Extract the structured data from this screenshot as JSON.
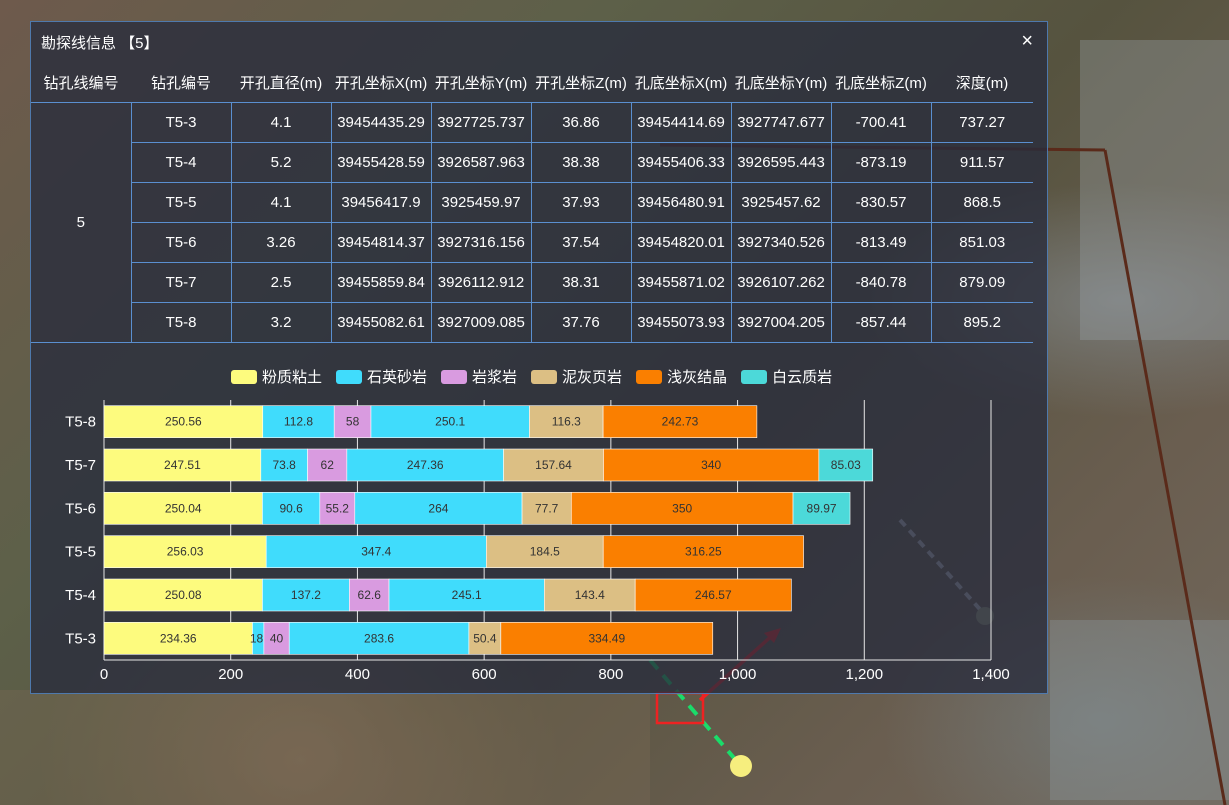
{
  "dialog": {
    "title": "勘探线信息 【5】",
    "close_symbol": "×"
  },
  "table": {
    "headers": [
      "钻孔线编号",
      "钻孔编号",
      "开孔直径(m)",
      "开孔坐标X(m)",
      "开孔坐标Y(m)",
      "开孔坐标Z(m)",
      "孔底坐标X(m)",
      "孔底坐标Y(m)",
      "孔底坐标Z(m)",
      "深度(m)"
    ],
    "group_value": "5",
    "rows": [
      [
        "T5-3",
        "4.1",
        "39454435.29",
        "3927725.737",
        "36.86",
        "39454414.69",
        "3927747.677",
        "-700.41",
        "737.27"
      ],
      [
        "T5-4",
        "5.2",
        "39455428.59",
        "3926587.963",
        "38.38",
        "39455406.33",
        "3926595.443",
        "-873.19",
        "911.57"
      ],
      [
        "T5-5",
        "4.1",
        "39456417.9",
        "3925459.97",
        "37.93",
        "39456480.91",
        "3925457.62",
        "-830.57",
        "868.5"
      ],
      [
        "T5-6",
        "3.26",
        "39454814.37",
        "3927316.156",
        "37.54",
        "39454820.01",
        "3927340.526",
        "-813.49",
        "851.03"
      ],
      [
        "T5-7",
        "2.5",
        "39455859.84",
        "3926112.912",
        "38.31",
        "39455871.02",
        "3926107.262",
        "-840.78",
        "879.09"
      ],
      [
        "T5-8",
        "3.2",
        "39455082.61",
        "3927009.085",
        "37.76",
        "39455073.93",
        "3927004.205",
        "-857.44",
        "895.2"
      ]
    ]
  },
  "chart_data": {
    "type": "bar",
    "orientation": "horizontal",
    "stacked": true,
    "categories": [
      "T5-3",
      "T5-4",
      "T5-5",
      "T5-6",
      "T5-7",
      "T5-8"
    ],
    "xlim": [
      0,
      1400
    ],
    "x_ticks": [
      0,
      200,
      400,
      600,
      800,
      1000,
      1200,
      1400
    ],
    "x_tick_labels": [
      "0",
      "200",
      "400",
      "600",
      "800",
      "1,000",
      "1,200",
      "1,400"
    ],
    "legend": [
      "粉质粘土",
      "石英砂岩",
      "岩浆岩",
      "泥灰页岩",
      "浅灰结晶",
      "白云质岩"
    ],
    "legend_position": "top",
    "grid": true,
    "colors": {
      "粉质粘土": "#fdfb7e",
      "石英砂岩": "#40dcfc",
      "岩浆岩": "#d99be0",
      "泥灰页岩": "#dcbf84",
      "浅灰结晶": "#fa7f00",
      "白云质岩": "#4cd9d9"
    },
    "bars": {
      "T5-3": [
        {
          "layer": "粉质粘土",
          "value": 234.36,
          "label": "234.36"
        },
        {
          "layer": "石英砂岩",
          "value": 18,
          "label": "18."
        },
        {
          "layer": "岩浆岩",
          "value": 40,
          "label": "40"
        },
        {
          "layer": "石英砂岩",
          "value": 283.6,
          "label": "283.6"
        },
        {
          "layer": "泥灰页岩",
          "value": 50.4,
          "label": "50.4"
        },
        {
          "layer": "浅灰结晶",
          "value": 334.49,
          "label": "334.49"
        }
      ],
      "T5-4": [
        {
          "layer": "粉质粘土",
          "value": 250.08,
          "label": "250.08"
        },
        {
          "layer": "石英砂岩",
          "value": 137.2,
          "label": "137.2"
        },
        {
          "layer": "岩浆岩",
          "value": 62.6,
          "label": "62.6"
        },
        {
          "layer": "石英砂岩",
          "value": 245.1,
          "label": "245.1"
        },
        {
          "layer": "泥灰页岩",
          "value": 143.4,
          "label": "143.4"
        },
        {
          "layer": "浅灰结晶",
          "value": 246.57,
          "label": "246.57"
        }
      ],
      "T5-5": [
        {
          "layer": "粉质粘土",
          "value": 256.03,
          "label": "256.03"
        },
        {
          "layer": "石英砂岩",
          "value": 347.4,
          "label": "347.4"
        },
        {
          "layer": "泥灰页岩",
          "value": 184.5,
          "label": "184.5"
        },
        {
          "layer": "浅灰结晶",
          "value": 316.25,
          "label": "316.25"
        }
      ],
      "T5-6": [
        {
          "layer": "粉质粘土",
          "value": 250.04,
          "label": "250.04"
        },
        {
          "layer": "石英砂岩",
          "value": 90.6,
          "label": "90.6"
        },
        {
          "layer": "岩浆岩",
          "value": 55.2,
          "label": "55.2"
        },
        {
          "layer": "石英砂岩",
          "value": 264,
          "label": "264"
        },
        {
          "layer": "泥灰页岩",
          "value": 77.7,
          "label": "77.7"
        },
        {
          "layer": "浅灰结晶",
          "value": 350,
          "label": "350"
        },
        {
          "layer": "白云质岩",
          "value": 89.97,
          "label": "89.97"
        }
      ],
      "T5-7": [
        {
          "layer": "粉质粘土",
          "value": 247.51,
          "label": "247.51"
        },
        {
          "layer": "石英砂岩",
          "value": 73.8,
          "label": "73.8"
        },
        {
          "layer": "岩浆岩",
          "value": 62,
          "label": "62"
        },
        {
          "layer": "石英砂岩",
          "value": 247.36,
          "label": "247.36"
        },
        {
          "layer": "泥灰页岩",
          "value": 157.64,
          "label": "157.64"
        },
        {
          "layer": "浅灰结晶",
          "value": 340,
          "label": "340"
        },
        {
          "layer": "白云质岩",
          "value": 85.03,
          "label": "85.03"
        }
      ],
      "T5-8": [
        {
          "layer": "粉质粘土",
          "value": 250.56,
          "label": "250.56"
        },
        {
          "layer": "石英砂岩",
          "value": 112.8,
          "label": "112.8"
        },
        {
          "layer": "岩浆岩",
          "value": 58,
          "label": "58"
        },
        {
          "layer": "石英砂岩",
          "value": 250.1,
          "label": "250.1"
        },
        {
          "layer": "泥灰页岩",
          "value": 116.3,
          "label": "116.3"
        },
        {
          "layer": "浅灰结晶",
          "value": 242.73,
          "label": "242.73"
        }
      ]
    }
  }
}
